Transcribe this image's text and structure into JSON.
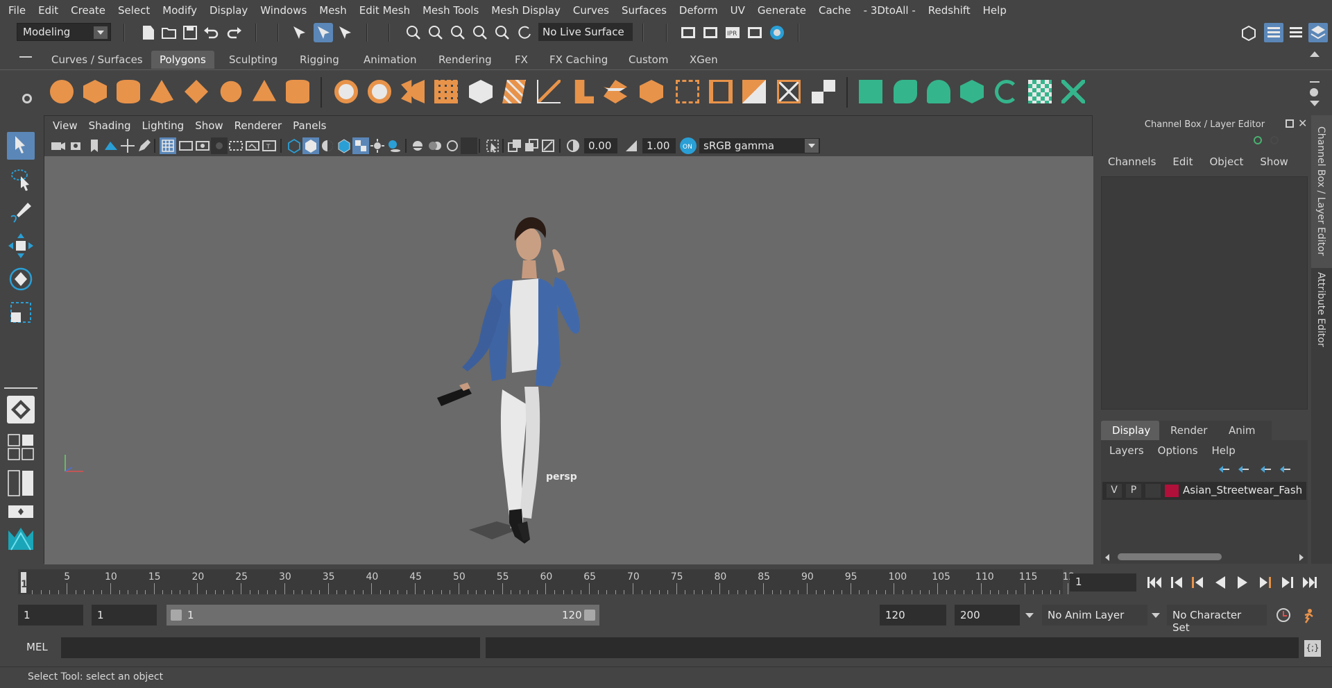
{
  "menu": [
    "File",
    "Edit",
    "Create",
    "Select",
    "Modify",
    "Display",
    "Windows",
    "Mesh",
    "Edit Mesh",
    "Mesh Tools",
    "Mesh Display",
    "Curves",
    "Surfaces",
    "Deform",
    "UV",
    "Generate",
    "Cache",
    "- 3DtoAll -",
    "Redshift",
    "Help"
  ],
  "status": {
    "menuset": "Modeling",
    "live_surface": "No Live Surface"
  },
  "shelf_tabs": [
    "Curves / Surfaces",
    "Polygons",
    "Sculpting",
    "Rigging",
    "Animation",
    "Rendering",
    "FX",
    "FX Caching",
    "Custom",
    "XGen"
  ],
  "shelf_active": "Polygons",
  "viewport": {
    "menu": [
      "View",
      "Shading",
      "Lighting",
      "Show",
      "Renderer",
      "Panels"
    ],
    "exposure": "0.00",
    "gamma": "1.00",
    "colorspace": "sRGB gamma",
    "camera_label": "persp"
  },
  "channel_box": {
    "title": "Channel Box / Layer Editor",
    "menu": [
      "Channels",
      "Edit",
      "Object",
      "Show"
    ]
  },
  "layer_editor": {
    "tabs": [
      "Display",
      "Render",
      "Anim"
    ],
    "menu": [
      "Layers",
      "Options",
      "Help"
    ],
    "layer": {
      "v": "V",
      "p": "P",
      "name": "Asian_Streetwear_Fash",
      "color": "#b0103a"
    }
  },
  "side_tabs": [
    "Channel Box / Layer Editor",
    "Attribute Editor"
  ],
  "timeline": {
    "ticks": [
      "5",
      "10",
      "15",
      "20",
      "25",
      "30",
      "35",
      "40",
      "45",
      "50",
      "55",
      "60",
      "65",
      "70",
      "75",
      "80",
      "85",
      "90",
      "95",
      "100",
      "105",
      "110",
      "115",
      "12"
    ],
    "current_marker": "1",
    "current_frame": "1"
  },
  "range": {
    "start": "1",
    "playback_start": "1",
    "slider_start": "1",
    "slider_end": "120",
    "playback_end": "120",
    "end": "200",
    "anim_layer": "No Anim Layer",
    "char_set": "No Character Set"
  },
  "command": {
    "lang": "MEL"
  },
  "help_line": "Select Tool: select an object",
  "colors": {
    "accent": "#5b87b8",
    "shelf_orange": "#e8934a",
    "shelf_green": "#35b58c",
    "toggle_on": "#2a9fd6"
  }
}
